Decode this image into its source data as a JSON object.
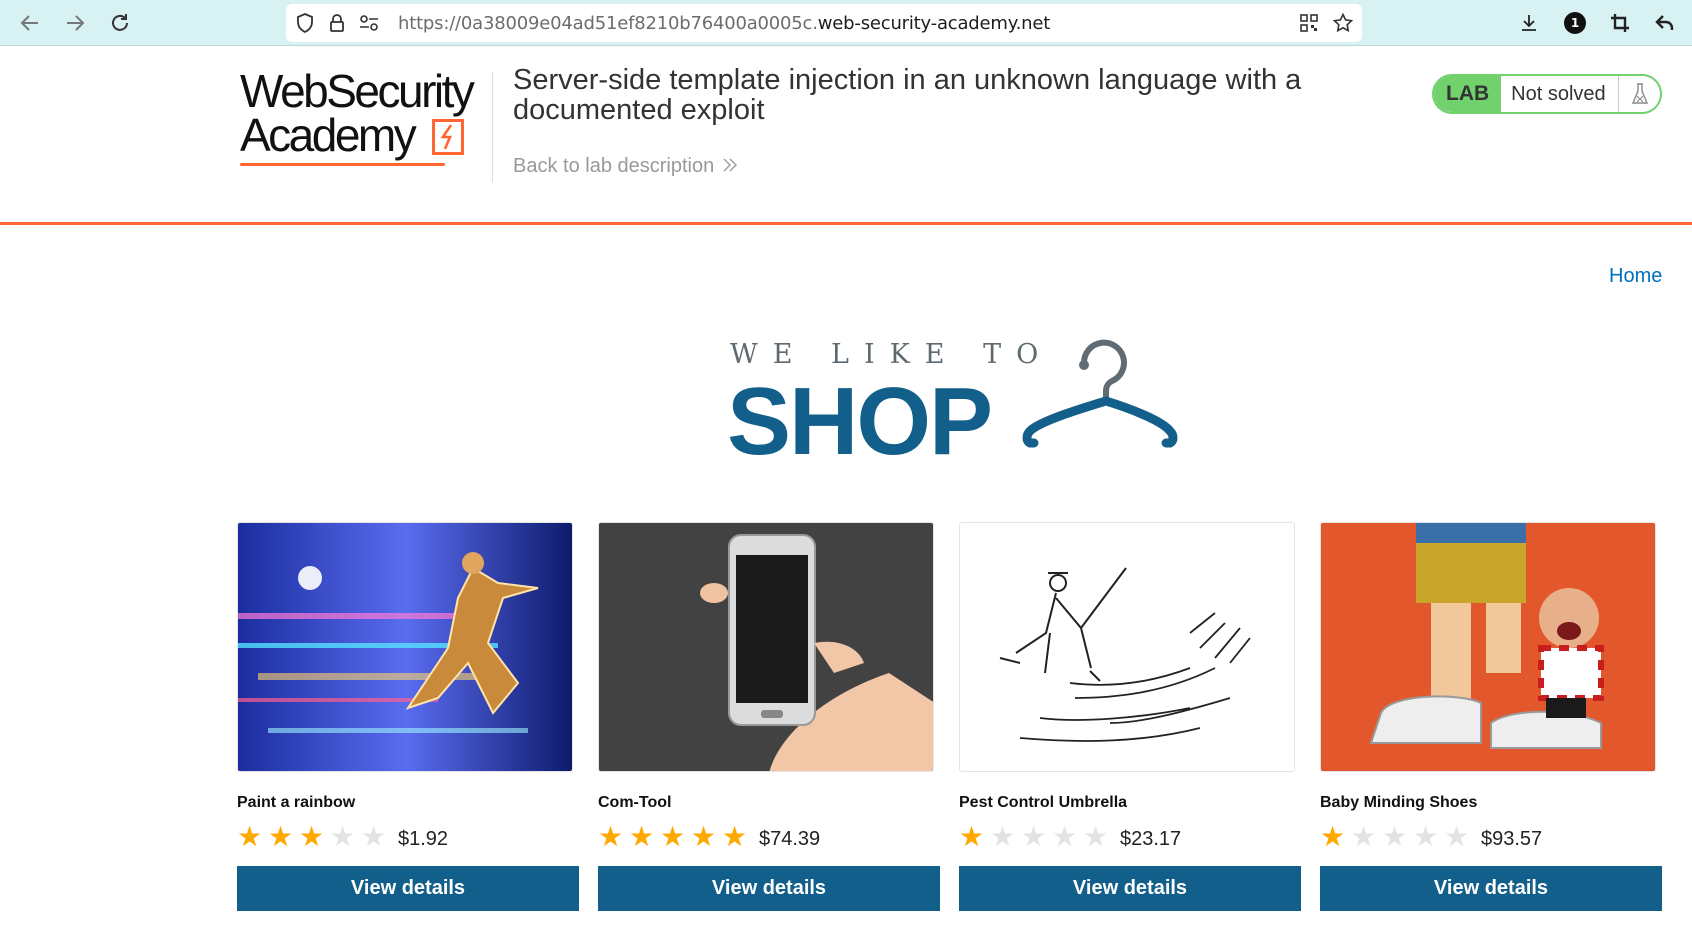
{
  "browser": {
    "url_prefix": "https://0a38009e04ad51ef8210b76400a0005c.",
    "url_domain": "web-security-academy.net",
    "notification_count": "1"
  },
  "academy": {
    "logo_line1": "WebSecurity",
    "logo_line2": "Academy",
    "lab_title": "Server-side template injection in an unknown language with a documented exploit",
    "back_link": "Back to lab description",
    "lab_badge": "LAB",
    "lab_status": "Not solved",
    "accent_color": "#ff6633",
    "status_color": "#70d16d"
  },
  "shop": {
    "home_link": "Home",
    "hero_tagline": "WE LIKE TO",
    "hero_word": "SHOP",
    "brand_color": "#135f8b",
    "products": [
      {
        "name": "Paint a rainbow",
        "rating": 3,
        "price": "$1.92",
        "button": "View details"
      },
      {
        "name": "Com-Tool",
        "rating": 5,
        "price": "$74.39",
        "button": "View details"
      },
      {
        "name": "Pest Control Umbrella",
        "rating": 1,
        "price": "$23.17",
        "button": "View details"
      },
      {
        "name": "Baby Minding Shoes",
        "rating": 1,
        "price": "$93.57",
        "button": "View details"
      }
    ]
  }
}
